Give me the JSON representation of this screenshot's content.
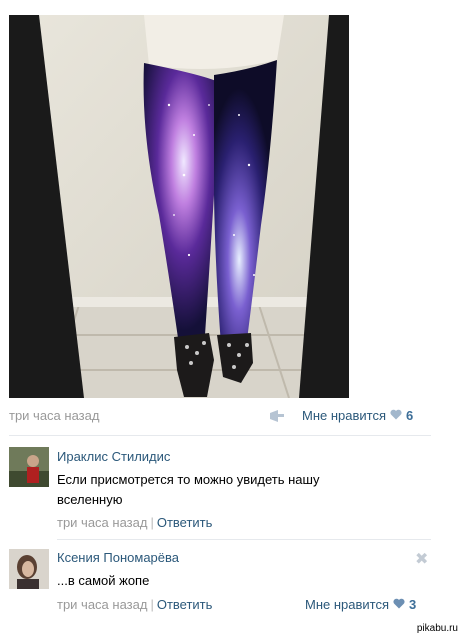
{
  "post": {
    "time": "три часа назад",
    "like_label": "Мне нравится",
    "like_count": "6"
  },
  "comments": [
    {
      "author": "Ираклис Стилидис",
      "text": "Если присмотрется то можно увидеть нашу вселенную",
      "time": "три часа назад",
      "reply": "Ответить"
    },
    {
      "author": "Ксения Пономарёва",
      "text": "...в самой жопе",
      "time": "три часа назад",
      "reply": "Ответить",
      "like_label": "Мне нравится",
      "like_count": "3"
    }
  ],
  "watermark": "pikabu.ru",
  "colors": {
    "link": "#2b587a",
    "meta": "#999999",
    "heart": "#a2b7cc"
  }
}
